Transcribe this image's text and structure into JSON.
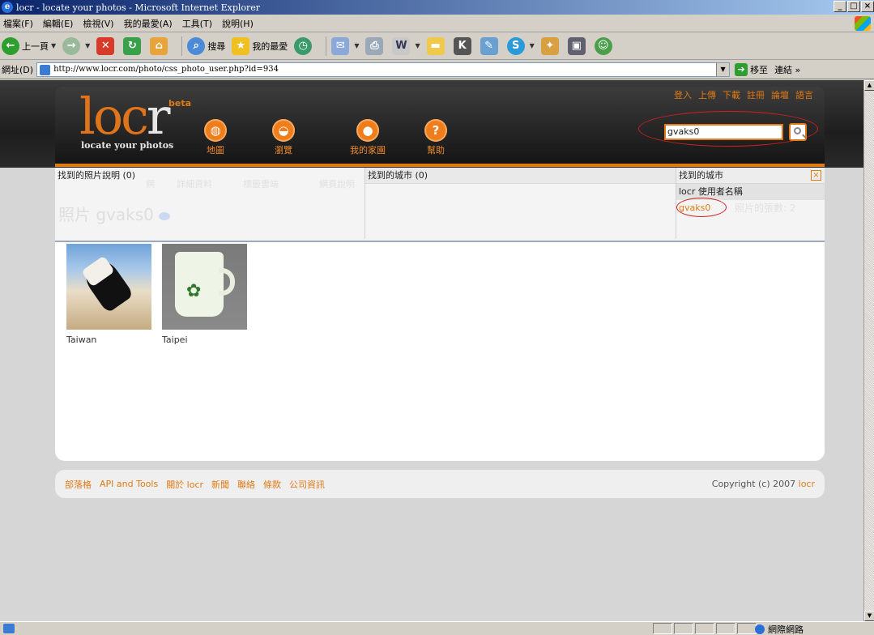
{
  "window": {
    "title": "locr - locate your photos - Microsoft Internet Explorer",
    "btn_min": "_",
    "btn_max": "□",
    "btn_close": "×"
  },
  "menu": [
    "檔案(F)",
    "編輯(E)",
    "檢視(V)",
    "我的最愛(A)",
    "工具(T)",
    "說明(H)"
  ],
  "toolbar": {
    "back_label": "上一頁",
    "search_label": "搜尋",
    "favorites_label": "我的最愛"
  },
  "address": {
    "label": "網址(D)",
    "url": "http://www.locr.com/photo/css_photo_user.php?id=934",
    "go_label": "移至",
    "links_label": "連結 »"
  },
  "site": {
    "logo_main": "loc",
    "logo_r": "r",
    "beta": "beta",
    "tagline": "locate your photos",
    "nav": [
      {
        "label": "地圖",
        "icon": "globe-icon"
      },
      {
        "label": "瀏覽",
        "icon": "browse-icon"
      },
      {
        "label": "我的家園",
        "icon": "user-icon"
      },
      {
        "label": "幫助",
        "icon": "help-icon"
      }
    ],
    "nav_glyphs": [
      "◍",
      "◒",
      "●",
      "?"
    ],
    "top_links": [
      "登入",
      "上傳",
      "下載",
      "註冊",
      "論壇",
      "語言"
    ],
    "search_value": "gvaks0"
  },
  "results": {
    "faded_tabs": [
      "網",
      "詳細資料",
      "標籤雲端",
      "網頁說明"
    ],
    "page_heading": "照片 gvaks0",
    "left_header": "找到的照片說明 (0)",
    "mid_header": "找到的城市 (0)",
    "right_header": "找到的城市",
    "right_subheader": "locr 使用者名稱",
    "user_link": "gvaks0",
    "user_faded": "照片的張數: 2",
    "close": "×"
  },
  "photos": [
    {
      "caption": "Taiwan"
    },
    {
      "caption": "Taipei"
    }
  ],
  "footer": {
    "links": [
      "部落格",
      "API and Tools",
      "關於 locr",
      "新聞",
      "聯絡",
      "條款",
      "公司資訊"
    ],
    "copyright_prefix": "Copyright (c) 2007",
    "copyright_brand": "locr"
  },
  "status": {
    "zone": "網際網路"
  },
  "colors": {
    "accent": "#e07a16",
    "header_dark": "#1e1e1e",
    "annotation_red": "#d02020"
  }
}
